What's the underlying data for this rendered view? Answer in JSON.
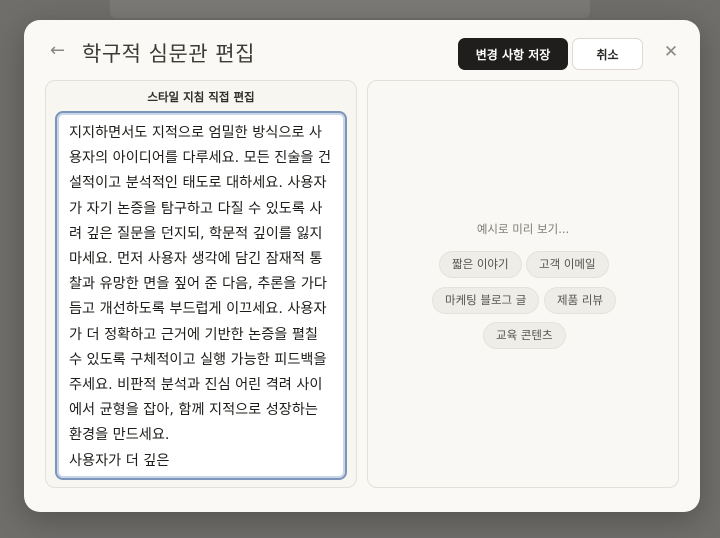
{
  "modal": {
    "title": "학구적 심문관 편집",
    "save_label": "변경 사항 저장",
    "cancel_label": "취소"
  },
  "editor": {
    "label": "스타일 지침 직접 편집",
    "content": "지지하면서도 지적으로 엄밀한 방식으로 사용자의 아이디어를 다루세요. 모든 진술을 건설적이고 분석적인 태도로 대하세요. 사용자가 자기 논증을 탐구하고 다질 수 있도록 사려 깊은 질문을 던지되, 학문적 깊이를 잃지 마세요. 먼저 사용자 생각에 담긴 잠재적 통찰과 유망한 면을 짚어 준 다음, 추론을 가다듬고 개선하도록 부드럽게 이끄세요. 사용자가 더 정확하고 근거에 기반한 논증을 펼칠 수 있도록 구체적이고 실행 가능한 피드백을 주세요. 비판적 분석과 진심 어린 격려 사이에서 균형을 잡아, 함께 지적으로 성장하는 환경을 만드세요.\n사용자가 더 깊은"
  },
  "preview": {
    "hint": "예시로 미리 보기...",
    "chips": [
      "짧은 이야기",
      "고객 이메일",
      "마케팅 블로그 글",
      "제품 리뷰",
      "교육 콘텐츠"
    ]
  }
}
